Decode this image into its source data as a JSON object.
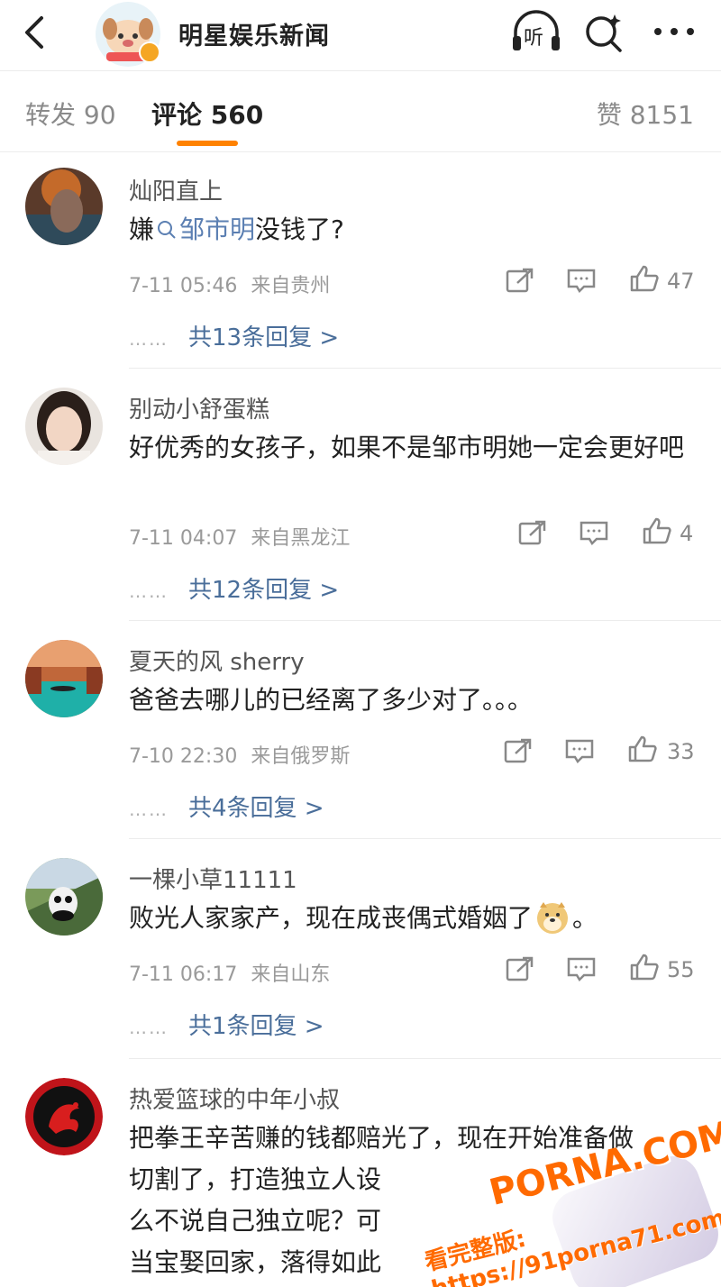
{
  "header": {
    "back_icon": "chevron-left-icon",
    "account_name": "明星娱乐新闻",
    "listen_label": "听",
    "search_icon": "ai-search-icon",
    "more_icon": "more-horizontal-icon"
  },
  "tabs": {
    "repost": "转发 90",
    "comment": "评论 560",
    "like": "赞 8151",
    "active_color": "#ff8200"
  },
  "comments": [
    {
      "user": "灿阳直上",
      "text_prefix": "嫌",
      "search_link": "邹市明",
      "text_suffix": "没钱了?",
      "time": "7-11 05:46",
      "location": "来自贵州",
      "likes": "47",
      "replies": "共13条回复 >"
    },
    {
      "user": "别动小舒蛋糕",
      "text": "好优秀的女孩子，如果不是邹市明她一定会更好吧",
      "time": "7-11 04:07",
      "location": "来自黑龙江",
      "likes": "4",
      "replies": "共12条回复 >"
    },
    {
      "user": "夏天的风 sherry",
      "text": "爸爸去哪儿的已经离了多少对了。。。",
      "time": "7-10 22:30",
      "location": "来自俄罗斯",
      "likes": "33",
      "replies": "共4条回复 >"
    },
    {
      "user": "一棵小草11111",
      "text": "败光人家家产，现在成丧偶式婚姻了",
      "text_end": "。",
      "time": "7-11 06:17",
      "location": "来自山东",
      "likes": "55",
      "replies": "共1条回复 >"
    },
    {
      "user": "热爱篮球的中年小叔",
      "line1": "把拳王辛苦赚的钱都赔光了，现在开始准备做",
      "line2": "切割了，打造独立人设",
      "line3": "么不说自己独立呢？可",
      "line4": "当宝娶回家，落得如此"
    }
  ],
  "reply_dots": "……",
  "watermark": {
    "brand": "PORNA.COM",
    "line": "看完整版: https://91porna71.com"
  }
}
